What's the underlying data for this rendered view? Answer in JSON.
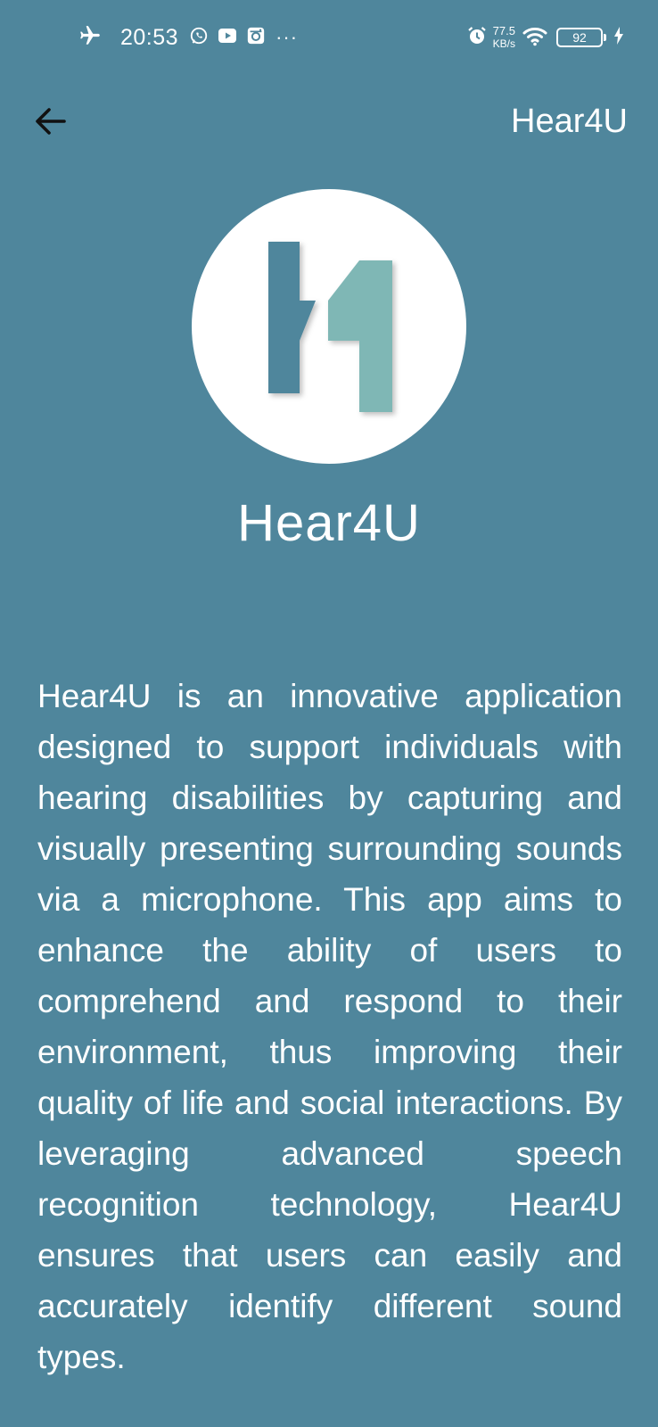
{
  "status_bar": {
    "time": "20:53",
    "network_speed_value": "77.5",
    "network_speed_unit": "KB/s",
    "battery_level": "92",
    "more_indicator": "···",
    "icons": [
      "airplane-mode-icon",
      "whatsapp-icon",
      "youtube-icon",
      "instagram-icon",
      "alarm-icon",
      "wifi-icon",
      "battery-icon",
      "charging-icon"
    ]
  },
  "app_bar": {
    "back_icon": "arrow-left-icon",
    "title": "Hear4U"
  },
  "logo": {
    "name": "hear4u-logo",
    "colors": {
      "circle": "#ffffff",
      "left_bar": "#4f869c",
      "right_bar": "#7fb7b5"
    }
  },
  "app_name": "Hear4U",
  "description": "Hear4U is an innovative application designed to support individuals with hearing disabilities by capturing and visually presenting surrounding sounds via a microphone. This app aims to enhance the ability of users to comprehend and respond to their environment, thus improving their quality of life and social interactions. By leveraging advanced speech recognition technology, Hear4U ensures that users can easily and accurately identify different sound types.",
  "theme": {
    "background": "#4f869c",
    "text": "#ffffff"
  }
}
